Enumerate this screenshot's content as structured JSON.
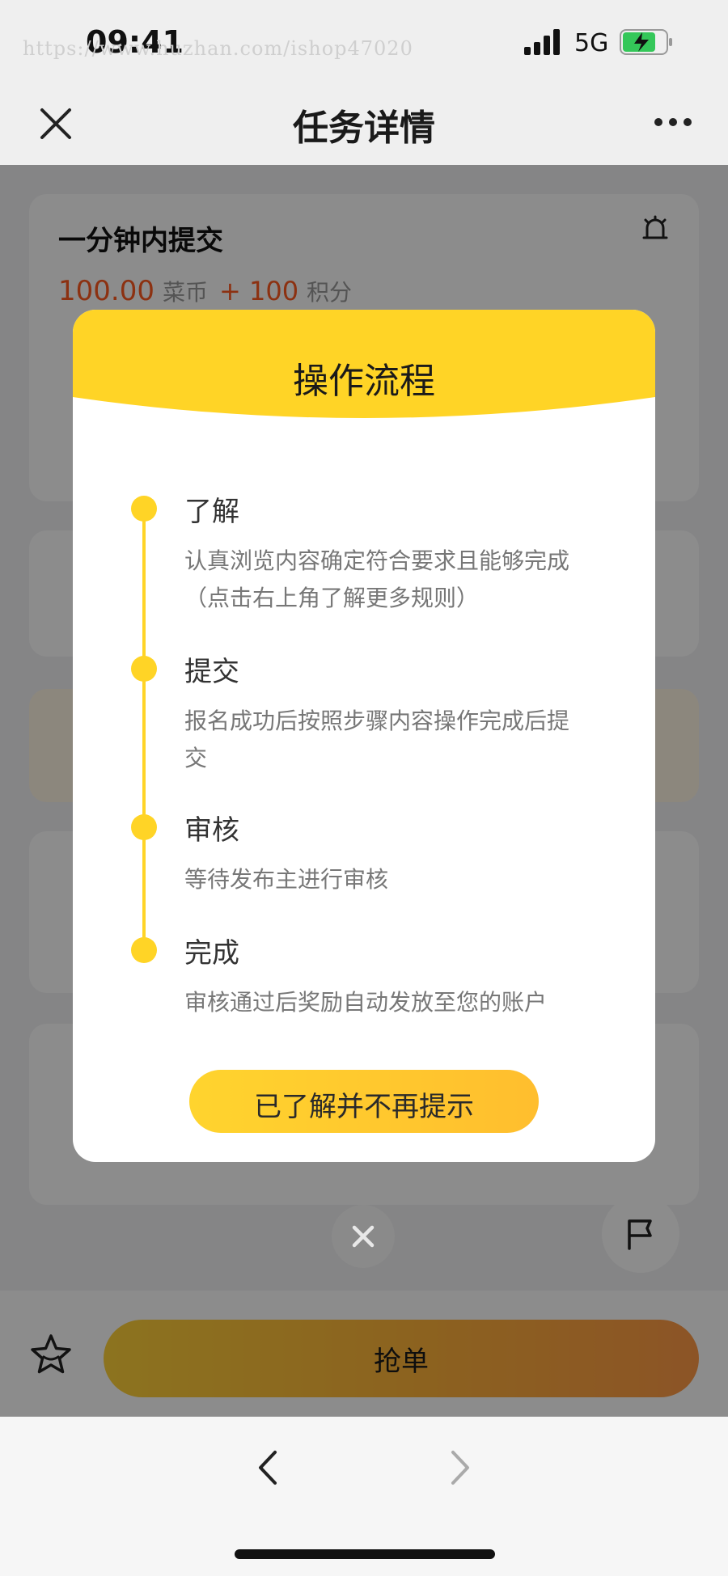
{
  "status_bar": {
    "time": "09:41",
    "watermark": "https://www.huzhan.com/ishop47020",
    "network": "5G"
  },
  "nav": {
    "title": "任务详情",
    "close_icon": "close-icon",
    "more_icon": "more-icon"
  },
  "task": {
    "title": "一分钟内提交",
    "reward_amount": "100.00",
    "reward_unit": "菜币",
    "points": "+ 100",
    "points_unit": "积分"
  },
  "bottom": {
    "grab_label": "抢单",
    "star_icon": "star-icon",
    "flag_icon": "flag-icon"
  },
  "modal": {
    "title": "操作流程",
    "steps": [
      {
        "title": "了解",
        "desc": "认真浏览内容确定符合要求且能够完成（点击右上角了解更多规则）"
      },
      {
        "title": "提交",
        "desc": "报名成功后按照步骤内容操作完成后提交"
      },
      {
        "title": "审核",
        "desc": "等待发布主进行审核"
      },
      {
        "title": "完成",
        "desc": "审核通过后奖励自动发放至您的账户"
      }
    ],
    "confirm_label": "已了解并不再提示"
  },
  "colors": {
    "accent": "#ffd426",
    "reward": "#ff5a1f",
    "overlay": "rgba(0,0,0,0.45)"
  }
}
